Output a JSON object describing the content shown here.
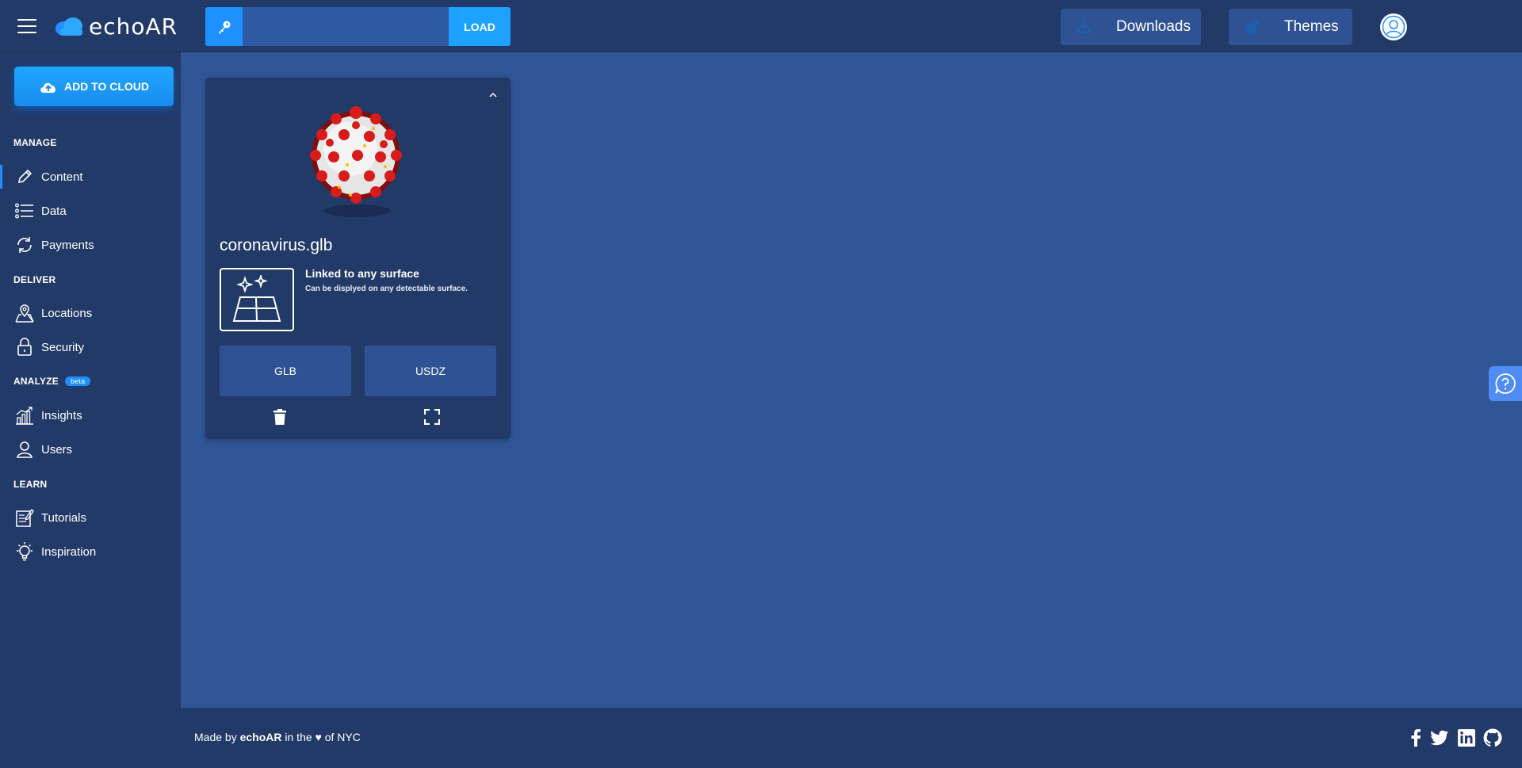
{
  "app": {
    "logo_text": "echoAR"
  },
  "header": {
    "key_input": {
      "value": "",
      "placeholder": ""
    },
    "load_label": "LOAD",
    "downloads_label": "Downloads",
    "themes_label": "Themes"
  },
  "sidebar": {
    "add_to_cloud_label": "ADD TO CLOUD",
    "sections": {
      "manage": "MANAGE",
      "deliver": "DELIVER",
      "analyze": "ANALYZE",
      "analyze_badge": "beta",
      "learn": "LEARN"
    },
    "items": {
      "content": "Content",
      "data": "Data",
      "payments": "Payments",
      "locations": "Locations",
      "security": "Security",
      "insights": "Insights",
      "users": "Users",
      "tutorials": "Tutorials",
      "inspiration": "Inspiration"
    },
    "active_item": "Content"
  },
  "card": {
    "file_name": "coronavirus.glb",
    "surface_title": "Linked to any surface",
    "surface_desc": "Can be displyed on any detectable surface.",
    "glb_label": "GLB",
    "usdz_label": "USDZ"
  },
  "footer": {
    "made_by_prefix": "Made by",
    "brand": "echoAR",
    "middle": "in the",
    "heart": "♥",
    "suffix": "of NYC"
  },
  "colors": {
    "background": "#2f5597",
    "panel": "#223a68",
    "accent": "#1e90ff",
    "button": "#2e5294"
  },
  "icons": {
    "hamburger": "menu-icon",
    "key": "key-icon",
    "downloads": "download-icon",
    "themes": "palette-icon",
    "avatar": "user-icon",
    "help": "help-icon"
  }
}
